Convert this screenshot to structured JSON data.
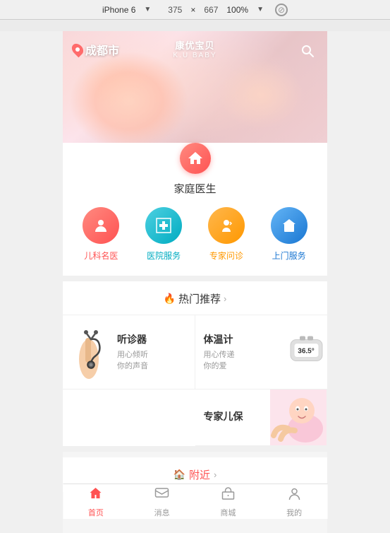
{
  "topBar": {
    "device": "iPhone 6",
    "arrow": "▼",
    "width": "375",
    "cross": "×",
    "height": "667",
    "percent": "100%",
    "percentArrow": "▼"
  },
  "hero": {
    "location": "成都市",
    "logoMain": "康优宝贝",
    "logoSub": "K.U BABY",
    "searchIcon": "🔍"
  },
  "doctorSection": {
    "title": "家庭医生",
    "services": [
      {
        "label": "儿科名医",
        "colorClass": "pink",
        "labelClass": "pink-text",
        "icon": "👨‍⚕️"
      },
      {
        "label": "医院服务",
        "colorClass": "teal",
        "labelClass": "teal-text",
        "icon": "➕"
      },
      {
        "label": "专家问诊",
        "colorClass": "orange",
        "labelClass": "orange-text",
        "icon": "🩺"
      },
      {
        "label": "上门服务",
        "colorClass": "blue",
        "labelClass": "blue-text",
        "icon": "💼"
      }
    ]
  },
  "hotSection": {
    "fireIcon": "🔥",
    "title": "热门推荐",
    "arrowText": ">",
    "items": [
      {
        "title": "听诊器",
        "desc": "用心倾听\n你的声音",
        "hasImage": true,
        "imageType": "stethoscope"
      },
      {
        "title": "体温计",
        "desc": "用心传递\n你的爱",
        "hasImage": true,
        "imageType": "thermometer"
      },
      {
        "title": "专家儿保",
        "desc": "",
        "hasImage": true,
        "imageType": "baby"
      }
    ]
  },
  "nearbySection": {
    "fireIcon": "🏠",
    "title": "附近",
    "arrowText": ">"
  },
  "bottomNav": [
    {
      "label": "首页",
      "icon": "home",
      "active": true
    },
    {
      "label": "消息",
      "icon": "message",
      "active": false
    },
    {
      "label": "商城",
      "icon": "shop",
      "active": false
    },
    {
      "label": "我的",
      "icon": "person",
      "active": false
    }
  ]
}
